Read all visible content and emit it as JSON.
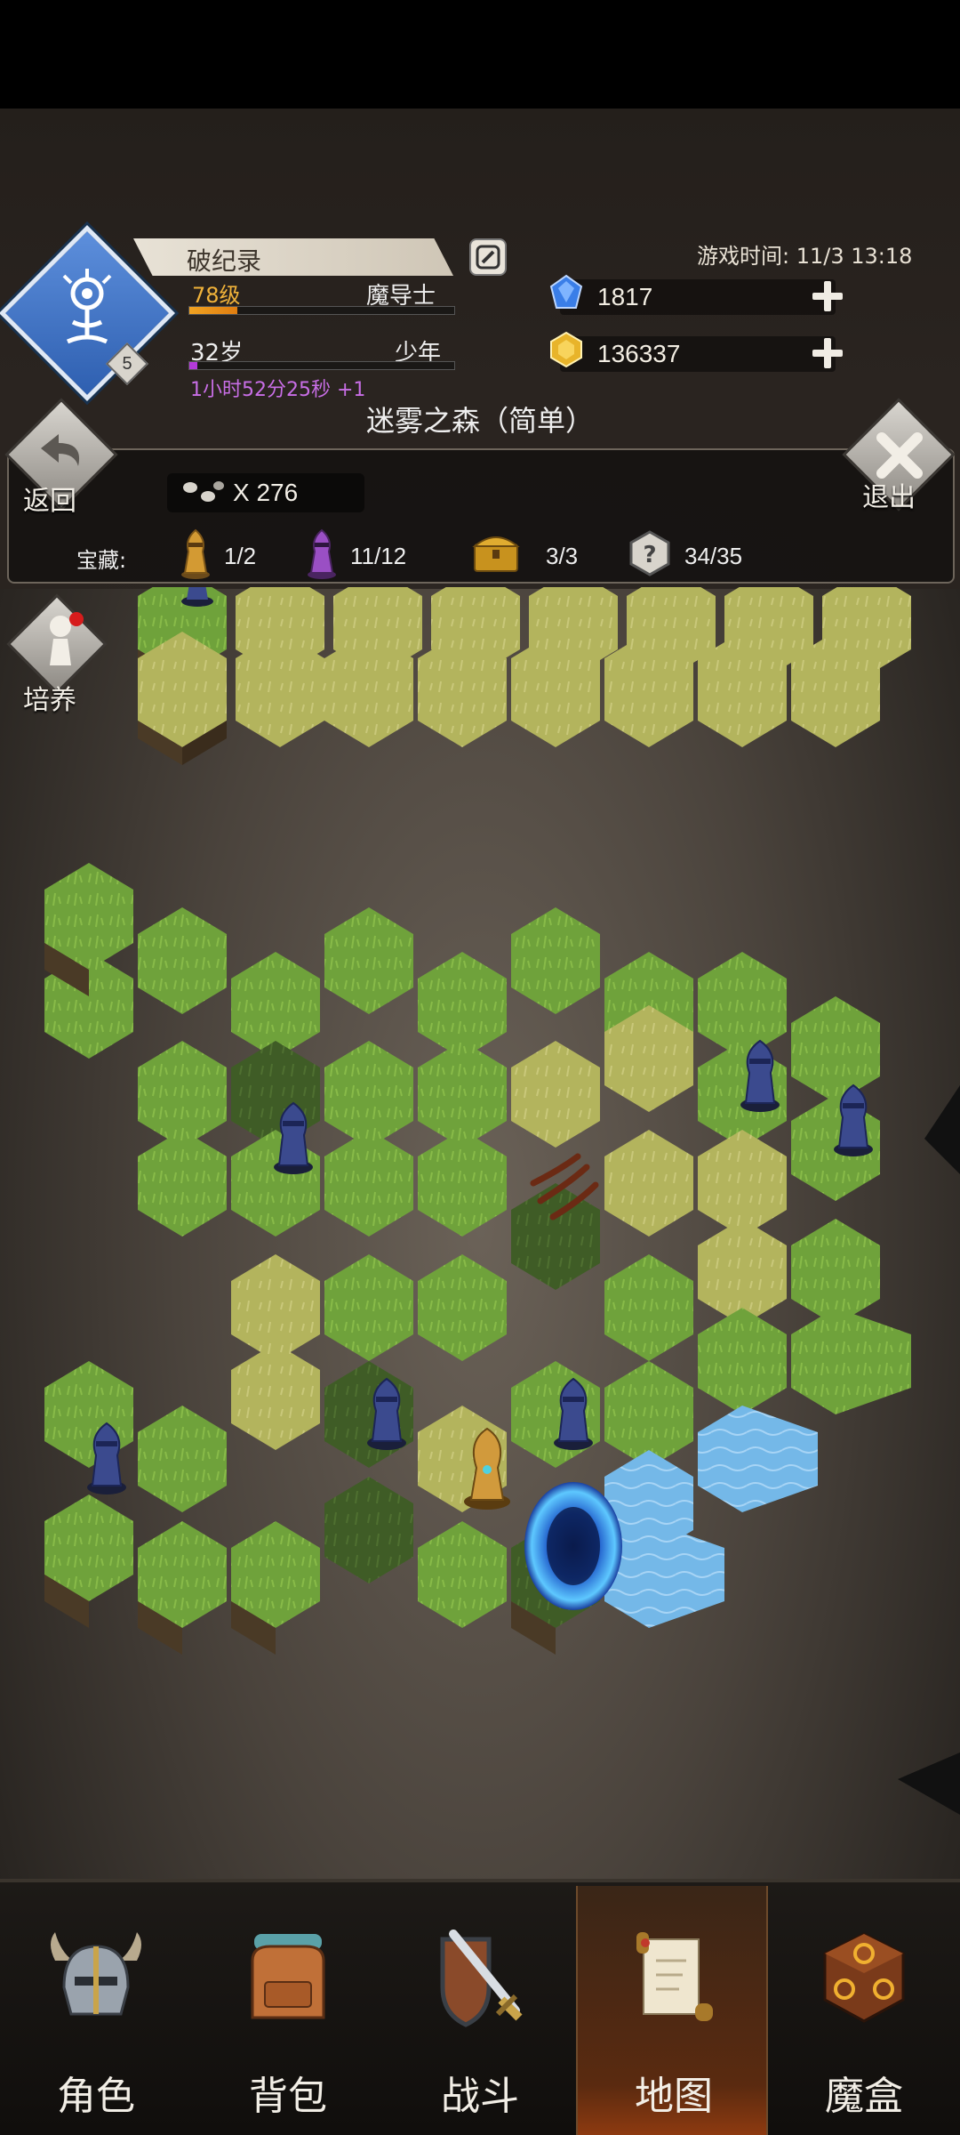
{
  "player": {
    "title": "破纪录",
    "level": "78级",
    "class": "魔导士",
    "xp_fraction": 0.18,
    "age": "32岁",
    "stage": "少年",
    "age_fraction": 0.03,
    "timer": "1小时52分25秒 +1",
    "avatar_badge": "5"
  },
  "game_time": "游戏时间: 11/3 13:18",
  "resources": {
    "gems": "1817",
    "gold": "136337"
  },
  "map": {
    "title": "迷雾之森（简单）",
    "back_label": "返回",
    "exit_label": "退出",
    "train_label": "培养",
    "footprints": "X 276",
    "treasure_label": "宝藏:",
    "treasures": [
      {
        "icon": "gold-knight-icon",
        "value": "1/2"
      },
      {
        "icon": "purple-knight-icon",
        "value": "11/12"
      },
      {
        "icon": "treasure-chest-icon",
        "value": "3/3"
      },
      {
        "icon": "mystery-hex-icon",
        "value": "34/35"
      }
    ]
  },
  "nav": {
    "items": [
      {
        "label": "角色",
        "icon": "helmet-icon"
      },
      {
        "label": "背包",
        "icon": "backpack-icon"
      },
      {
        "label": "战斗",
        "icon": "sword-shield-icon"
      },
      {
        "label": "地图",
        "icon": "scroll-map-icon",
        "active": true
      },
      {
        "label": "魔盒",
        "icon": "magic-box-icon"
      }
    ]
  },
  "colors": {
    "accent_gold": "#f1b33a",
    "accent_purple": "#c86ee6",
    "gem_blue": "#3a7ee8",
    "grass": "#6fa23b",
    "dry_grass": "#b6b560",
    "water": "#6fb7e8"
  }
}
